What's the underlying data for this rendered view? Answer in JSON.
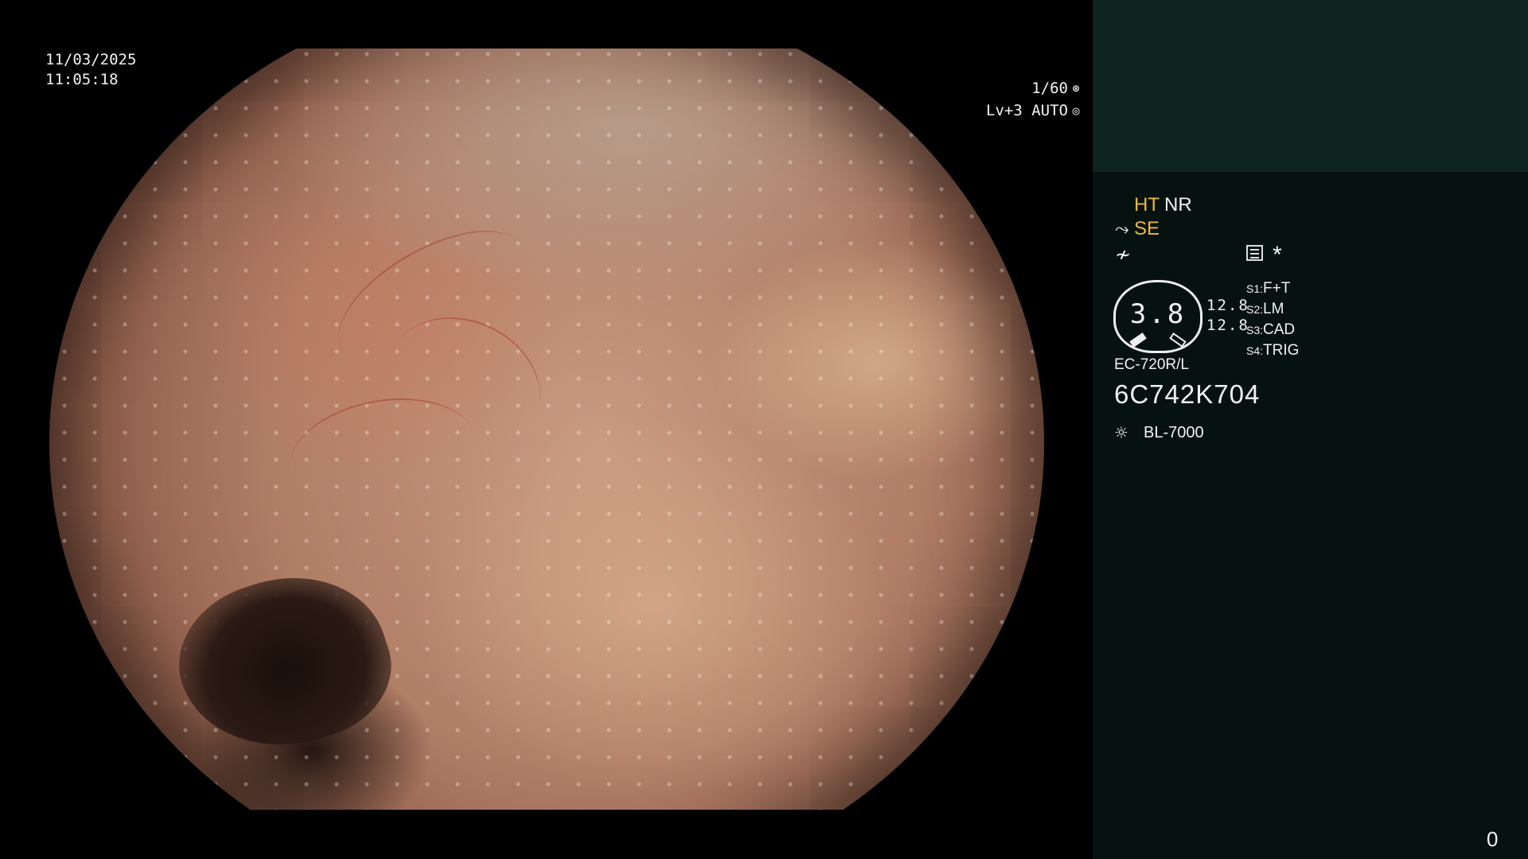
{
  "overlay": {
    "date": "11/03/2025",
    "time": "11:05:18",
    "shutter": "1/60",
    "shutter_icon": "aperture-icon",
    "level": "Lv+3 AUTO",
    "auto_icon": "iris-icon"
  },
  "panel": {
    "ht": "HT",
    "nr": "NR",
    "se": "SE",
    "se_icon": "enhancement-curve-icon",
    "f_icon": "freeze-icon",
    "menu_icon": "list-icon",
    "star": "*",
    "gauge_value": "3.8",
    "gauge_nums": [
      "12.8",
      "12.8"
    ],
    "scenes": [
      {
        "key": "S1:",
        "value": "F+T"
      },
      {
        "key": "S2:",
        "value": "LM"
      },
      {
        "key": "S3:",
        "value": "CAD"
      },
      {
        "key": "S4:",
        "value": "TRIG"
      }
    ],
    "scope_model": "EC-720R/L",
    "serial": "6C742K704",
    "lamp_icon": "light-source-icon",
    "light_source": "BL-7000",
    "counter": "0"
  },
  "colors": {
    "accent_yellow": "#f0b73a",
    "panel_bg": "#051210",
    "panel_top_bg": "#0d2421"
  }
}
